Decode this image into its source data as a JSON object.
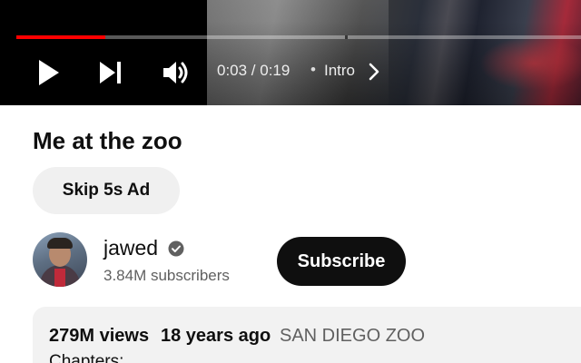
{
  "player": {
    "progress_fraction": 0.158,
    "buffered_chapter_markers": [
      "chapter-break"
    ],
    "time_display": "0:03 / 0:19",
    "separator": "•",
    "chapter_label": "Intro",
    "accent_color": "#ff0000",
    "icons": [
      "play-icon",
      "next-icon",
      "volume-icon",
      "chevron-right-icon"
    ]
  },
  "video": {
    "title": "Me at the zoo"
  },
  "ad": {
    "skip_label": "Skip 5s Ad"
  },
  "channel": {
    "name": "jawed",
    "verified_icon": "verified-check-icon",
    "subscribers": "3.84M subscribers",
    "subscribe_label": "Subscribe"
  },
  "description": {
    "views": "279M views",
    "age": "18 years ago",
    "hashtag": "SAN DIEGO ZOO",
    "chapters_label": "Chapters:"
  }
}
